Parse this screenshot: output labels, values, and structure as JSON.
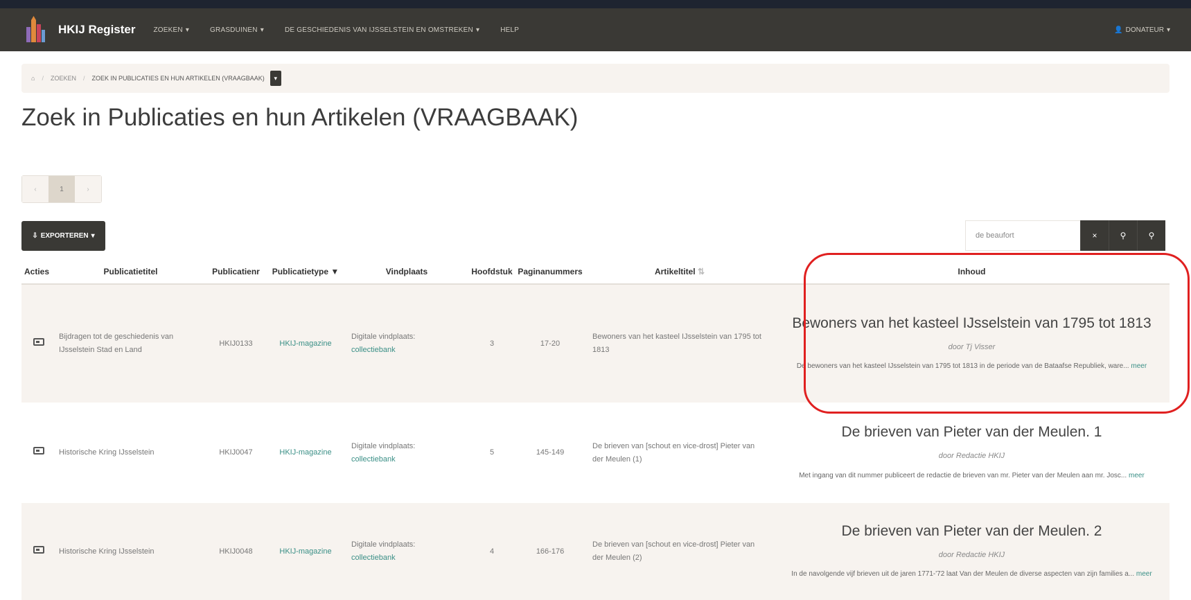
{
  "navbar": {
    "brand": "HKIJ Register",
    "items": [
      "ZOEKEN",
      "GRASDUINEN",
      "DE GESCHIEDENIS VAN IJSSELSTEIN EN OMSTREKEN",
      "HELP"
    ],
    "user": "DONATEUR"
  },
  "breadcrumb": {
    "items": [
      "ZOEKEN",
      "ZOEK IN PUBLICATIES EN HUN ARTIKELEN (VRAAGBAAK)"
    ]
  },
  "page_title": "Zoek in Publicaties en hun Artikelen (VRAAGBAAK)",
  "pagination": {
    "prev": "‹",
    "current": "1",
    "next": "›"
  },
  "toolbar": {
    "export_label": "EXPORTEREN"
  },
  "search": {
    "value": "de beaufort"
  },
  "table": {
    "headers": [
      "Acties",
      "Publicatietitel",
      "Publicatienr",
      "Publicatietype",
      "Vindplaats",
      "Hoofdstuk",
      "Paginanummers",
      "Artikeltitel",
      "Inhoud"
    ],
    "rows": [
      {
        "publicatietitel": "Bijdragen tot de geschiedenis van IJsselstein Stad en Land",
        "publicatienr": "HKIJ0133",
        "publicatietype": "HKIJ-magazine",
        "vindplaats_label": "Digitale vindplaats:",
        "vindplaats_link": "collectiebank",
        "hoofdstuk": "3",
        "paginanummers": "17-20",
        "artikeltitel": "Bewoners van het kasteel IJsselstein van 1795 tot 1813",
        "inhoud_title": "Bewoners van het kasteel IJsselstein van 1795 tot 1813",
        "inhoud_author": "door Tj Visser",
        "inhoud_desc": "De bewoners van het kasteel IJsselstein van 1795 tot 1813 in de periode van de Bataafse Republiek, ware...",
        "meer": "meer"
      },
      {
        "publicatietitel": "Historische Kring IJsselstein",
        "publicatienr": "HKIJ0047",
        "publicatietype": "HKIJ-magazine",
        "vindplaats_label": "Digitale vindplaats:",
        "vindplaats_link": "collectiebank",
        "hoofdstuk": "5",
        "paginanummers": "145-149",
        "artikeltitel": "De brieven van [schout en vice-drost] Pieter van der Meulen (1)",
        "inhoud_title": "De brieven van Pieter van der Meulen. 1",
        "inhoud_author": "door Redactie HKIJ",
        "inhoud_desc": "Met ingang van dit nummer publiceert de redactie de brieven van mr. Pieter van der Meulen aan mr. Josc...",
        "meer": "meer"
      },
      {
        "publicatietitel": "Historische Kring IJsselstein",
        "publicatienr": "HKIJ0048",
        "publicatietype": "HKIJ-magazine",
        "vindplaats_label": "Digitale vindplaats:",
        "vindplaats_link": "collectiebank",
        "hoofdstuk": "4",
        "paginanummers": "166-176",
        "artikeltitel": "De brieven van [schout en vice-drost] Pieter van der Meulen (2)",
        "inhoud_title": "De brieven van Pieter van der Meulen. 2",
        "inhoud_author": "door Redactie HKIJ",
        "inhoud_desc": "In de navolgende vijf brieven uit de jaren 1771-'72 laat Van der Meulen de diverse aspecten van zijn families a...",
        "meer": "meer"
      }
    ]
  },
  "colors": {
    "navbar": "#3a3935",
    "accent_link": "#3a8f86",
    "row_alt": "#f7f3ef",
    "highlight": "#e02020"
  }
}
